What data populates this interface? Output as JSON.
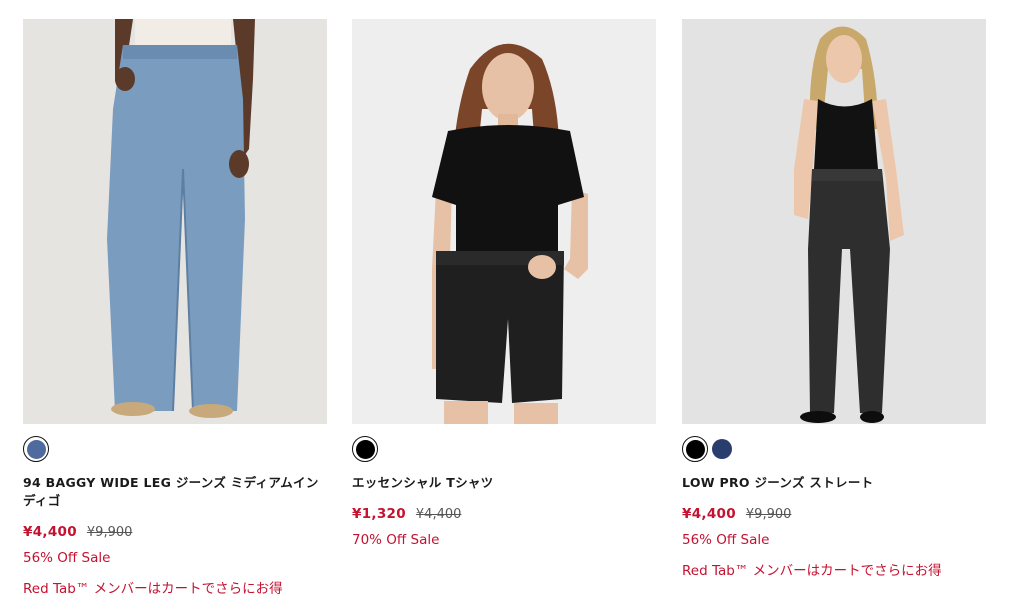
{
  "products": [
    {
      "name": "94 BAGGY WIDE LEG ジーンズ ミディアムインディゴ",
      "price": "¥4,400",
      "original_price": "¥9,900",
      "sale": "56% Off Sale",
      "promo": "Red Tab™ メンバーはカートでさらにお得",
      "swatches": [
        "#4f6a9c"
      ],
      "photo": "woman-baggy-wide-leg-jeans-photo"
    },
    {
      "name": "エッセンシャル Tシャツ",
      "price": "¥1,320",
      "original_price": "¥4,400",
      "sale": "70% Off Sale",
      "promo": "",
      "swatches": [
        "#000000"
      ],
      "photo": "woman-black-tshirt-photo"
    },
    {
      "name": "LOW PRO ジーンズ ストレート",
      "price": "¥4,400",
      "original_price": "¥9,900",
      "sale": "56% Off Sale",
      "promo": "Red Tab™ メンバーはカートでさらにお得",
      "swatches": [
        "#000000",
        "#2a3e6e"
      ],
      "photo": "woman-black-straight-jeans-photo"
    }
  ]
}
